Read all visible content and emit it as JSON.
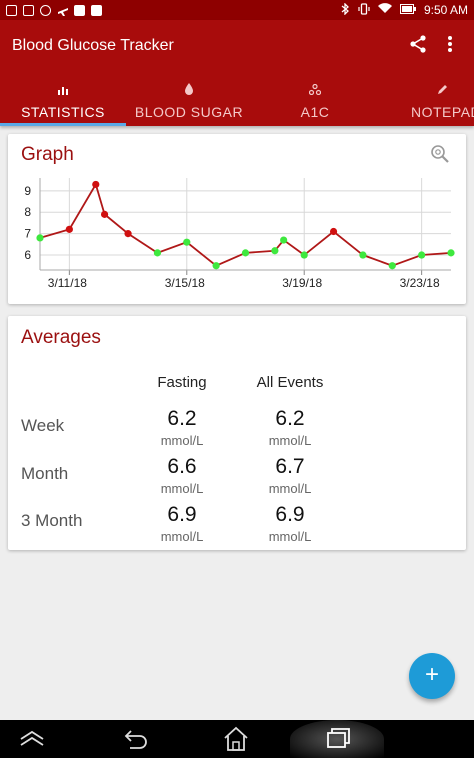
{
  "status_bar": {
    "time": "9:50 AM",
    "left_icons": [
      "image-icon",
      "email-icon",
      "shield-icon",
      "plane-icon",
      "facebook-icon",
      "notification-icon"
    ],
    "right_icons": [
      "bluetooth-icon",
      "vibrate-icon",
      "wifi-icon",
      "battery-icon"
    ]
  },
  "app_bar": {
    "title": "Blood Glucose Tracker",
    "actions": [
      "share-icon",
      "more-vertical-icon"
    ]
  },
  "tabs": [
    {
      "label": "STATISTICS",
      "icon": "bar-chart-icon",
      "active": true
    },
    {
      "label": "BLOOD SUGAR",
      "icon": "drop-icon",
      "active": false
    },
    {
      "label": "A1C",
      "icon": "molecule-icon",
      "active": false
    },
    {
      "label": "NOTEPAD",
      "icon": "pencil-icon",
      "active": false
    }
  ],
  "graph_card": {
    "title": "Graph",
    "zoom_icon": "zoom-icon"
  },
  "chart_data": {
    "type": "line",
    "title": "",
    "xlabel": "",
    "ylabel": "",
    "x_tick_labels": [
      "3/11/18",
      "3/15/18",
      "3/19/18",
      "3/23/18"
    ],
    "y_tick_labels": [
      "6",
      "7",
      "8",
      "9"
    ],
    "ylim": [
      5.3,
      9.6
    ],
    "grid": true,
    "line_color": "#b01818",
    "high_color": "#d01010",
    "normal_color": "#3ee83e",
    "points": [
      {
        "x": 0.0,
        "y": 6.8,
        "high": false
      },
      {
        "x": 1.0,
        "y": 7.2,
        "high": true
      },
      {
        "x": 1.9,
        "y": 9.3,
        "high": true
      },
      {
        "x": 2.2,
        "y": 7.9,
        "high": true
      },
      {
        "x": 3.0,
        "y": 7.0,
        "high": true
      },
      {
        "x": 4.0,
        "y": 6.1,
        "high": false
      },
      {
        "x": 5.0,
        "y": 6.6,
        "high": false
      },
      {
        "x": 6.0,
        "y": 5.5,
        "high": false
      },
      {
        "x": 7.0,
        "y": 6.1,
        "high": false
      },
      {
        "x": 8.0,
        "y": 6.2,
        "high": false
      },
      {
        "x": 8.3,
        "y": 6.7,
        "high": false
      },
      {
        "x": 9.0,
        "y": 6.0,
        "high": false
      },
      {
        "x": 10.0,
        "y": 7.1,
        "high": true
      },
      {
        "x": 11.0,
        "y": 6.0,
        "high": false
      },
      {
        "x": 12.0,
        "y": 5.5,
        "high": false
      },
      {
        "x": 13.0,
        "y": 6.0,
        "high": false
      },
      {
        "x": 14.0,
        "y": 6.1,
        "high": false
      }
    ]
  },
  "averages_card": {
    "title": "Averages",
    "columns": [
      "Fasting",
      "All Events"
    ],
    "rows": [
      {
        "label": "Week",
        "fasting": "6.2",
        "all": "6.2",
        "unit": "mmol/L"
      },
      {
        "label": "Month",
        "fasting": "6.6",
        "all": "6.7",
        "unit": "mmol/L"
      },
      {
        "label": "3 Month",
        "fasting": "6.9",
        "all": "6.9",
        "unit": "mmol/L"
      }
    ]
  },
  "fab": {
    "label": "+"
  },
  "nav_bar": {
    "buttons": [
      "collapse-icon",
      "back-icon",
      "home-icon",
      "recents-icon"
    ]
  },
  "colors": {
    "app_bar": "#a80c0c",
    "status_bar": "#8e0000",
    "accent": "#1e9bd7",
    "title_red": "#9b1010"
  }
}
